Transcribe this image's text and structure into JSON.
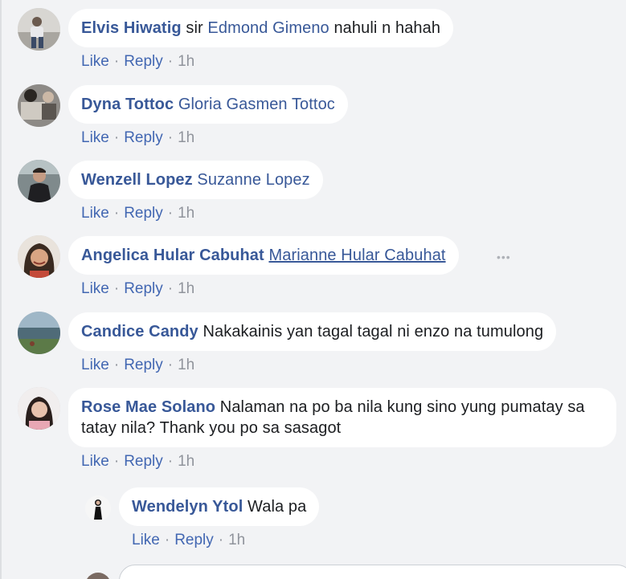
{
  "comments": [
    {
      "author": "Elvis Hiwatig",
      "parts": [
        {
          "t": "text",
          "v": "sir "
        },
        {
          "t": "mention",
          "v": "Edmond Gimeno"
        },
        {
          "t": "text",
          "v": " nahuli n hahah"
        }
      ],
      "like": "Like",
      "reply": "Reply",
      "time": "1h"
    },
    {
      "author": "Dyna Tottoc",
      "parts": [
        {
          "t": "mention",
          "v": "Gloria Gasmen Tottoc"
        }
      ],
      "like": "Like",
      "reply": "Reply",
      "time": "1h"
    },
    {
      "author": "Wenzell Lopez",
      "parts": [
        {
          "t": "mention",
          "v": "Suzanne Lopez"
        }
      ],
      "like": "Like",
      "reply": "Reply",
      "time": "1h"
    },
    {
      "author": "Angelica Hular Cabuhat",
      "parts": [
        {
          "t": "mention",
          "v": "Marianne Hular Cabuhat"
        }
      ],
      "like": "Like",
      "reply": "Reply",
      "time": "1h",
      "more": "•••"
    },
    {
      "author": "Candice Candy",
      "parts": [
        {
          "t": "text",
          "v": "Nakakainis yan tagal tagal ni enzo na tumulong"
        }
      ],
      "like": "Like",
      "reply": "Reply",
      "time": "1h"
    },
    {
      "author": "Rose Mae Solano",
      "parts": [
        {
          "t": "text",
          "v": "Nalaman na po ba nila kung sino yung pumatay sa tatay nila? Thank you po sa sasagot"
        }
      ],
      "like": "Like",
      "reply": "Reply",
      "time": "1h"
    }
  ],
  "reply": {
    "author": "Wendelyn Ytol",
    "text": "Wala pa",
    "like": "Like",
    "reply": "Reply",
    "time": "1h"
  },
  "separator": "·",
  "colors": {
    "link": "#385898",
    "meta": "#90949c",
    "bubble": "#ffffff",
    "background": "#f2f3f5"
  }
}
